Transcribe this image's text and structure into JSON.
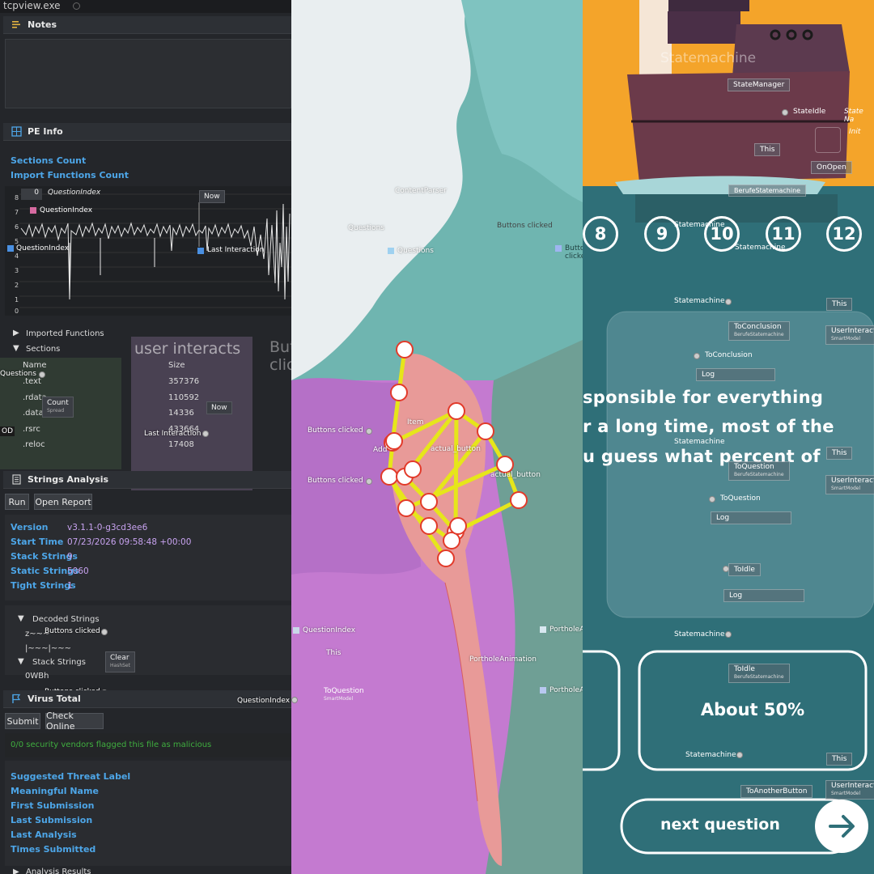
{
  "left": {
    "window_title": "tcpview.exe",
    "notes": {
      "title": "Notes"
    },
    "pe_info": {
      "title": "PE Info",
      "sections_count": "Sections Count",
      "import_functions_count": "Import Functions Count",
      "imported_functions": "Imported Functions",
      "sections": "Sections",
      "col_name": "Name",
      "col_size": "Size",
      "rows": [
        {
          "name": ".text",
          "size": "357376"
        },
        {
          "name": ".rdata",
          "size": "110592"
        },
        {
          "name": ".data",
          "size": "14336"
        },
        {
          "name": ".rsrc",
          "size": "433664"
        },
        {
          "name": ".reloc",
          "size": "17408"
        }
      ]
    },
    "graph": {
      "value_box": "0",
      "question_index_label": "QuestionIndex",
      "question_index_node": "QuestionIndex",
      "question_index_left": "QuestionIndex",
      "now_label": "Now",
      "last_interaction": "Last Interaction",
      "y_ticks": [
        "8",
        "7",
        "6",
        "5",
        "4",
        "3",
        "2",
        "1",
        "0"
      ]
    },
    "overlay": {
      "user_interacts": "user interacts",
      "buttons_clicked_big": "Buttons clicked",
      "questions": "Questions",
      "count": "Count",
      "count_sub": "Spread",
      "now2": "Now",
      "last_interaction2": "Last Interaction",
      "od": "OD",
      "buttons_clicked_1": "Buttons clicked",
      "clear": "Clear",
      "clear_sub": "HashSet",
      "buttons_clicked_2": "Buttons clicked",
      "question_index_right": "QuestionIndex"
    },
    "strings": {
      "title": "Strings Analysis",
      "run": "Run",
      "open_report": "Open Report",
      "fields": [
        {
          "label": "Version",
          "value": "v3.1.1-0-g3cd3ee6"
        },
        {
          "label": "Start Time",
          "value": "07/23/2026 09:58:48 +00:00"
        },
        {
          "label": "Stack Strings",
          "value": "9"
        },
        {
          "label": "Static Strings",
          "value": "5060"
        },
        {
          "label": "Tight Strings",
          "value": "1"
        }
      ],
      "decoded": "Decoded Strings",
      "decoded_a": "z~~~",
      "decoded_b": "|~~~|~~~",
      "stack": "Stack Strings",
      "stack_a": "0WBh"
    },
    "virus_total": {
      "title": "Virus Total",
      "submit": "Submit",
      "check_online": "Check Online",
      "flag_text": "0/0 security vendors flagged this file as malicious",
      "fields": [
        "Suggested Threat Label",
        "Meaningful Name",
        "First Submission",
        "Last Submission",
        "Last Analysis",
        "Times Submitted"
      ],
      "analysis_results": "Analysis Results"
    }
  },
  "middle": {
    "content_parser": "ContentParser",
    "questions_1": "Questions",
    "questions_2": "Questions",
    "buttons_clicked_top": "Buttons clicked",
    "buttons_clicked_top2": "Buttons clicked",
    "buttons_clicked_a": "Buttons clicked",
    "buttons_clicked_b": "Buttons clicked",
    "item": "Item",
    "add": "Add",
    "actual_button_1": "actual_button",
    "actual_button_2": "actual_button",
    "question_index": "QuestionIndex",
    "this": "This",
    "to_question": "ToQuestion",
    "to_question_sub": "SmartModel",
    "porthole_1": "PortholeAnimation",
    "porthole_2": "PortholeAnimation",
    "porthole_3": "PortholeAnimation"
  },
  "right": {
    "statemachine_title": "Statemachine",
    "state_manager": "StateManager",
    "state_idle": "StateIdle",
    "state_name": "State Na",
    "init": "Init",
    "this_top": "This",
    "on_open": "OnOpen",
    "berufe_sm": "BerufeStatemachine",
    "statemachine_a": "Statemachine",
    "statemachine_b": "Statemachine",
    "numbers": [
      "8",
      "9",
      "10",
      "11",
      "12"
    ],
    "sm_label_1": "Statemachine",
    "this_1": "This",
    "to_conclusion": "ToConclusion",
    "to_conclusion_sub": "BerufeStatemachine",
    "user_interact_1": "UserInteract",
    "smartmodel": "SmartModel",
    "to_conclusion_2": "ToConclusion",
    "log_1": "Log",
    "question_lines": [
      "sponsible for everything",
      "r a long time, most of the",
      "u guess what percent of"
    ],
    "sm_label_2": "Statemachine",
    "this_2": "This",
    "to_question": "ToQuestion",
    "to_question_sub": "BerufeStatemachine",
    "user_interact_2": "UserInteract",
    "to_question_2": "ToQuestion",
    "log_2": "Log",
    "to_idle": "ToIdle",
    "log_3": "Log",
    "sm_label_3": "Statemachine",
    "to_idle_2": "ToIdle",
    "to_idle_2_sub": "BerufeStatemachine",
    "answer": "About 50%",
    "sm_label_4": "Statemachine",
    "this_3": "This",
    "to_another_button": "ToAnotherButton",
    "user_interact_3": "UserInteract",
    "next_question": "next question",
    "colors": {
      "sea": "#2f6f78",
      "sky": "#f4a42a",
      "ship": "#6b3a4a",
      "white": "#ffffff"
    }
  }
}
